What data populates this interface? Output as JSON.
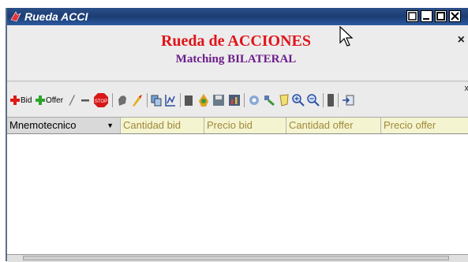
{
  "window": {
    "title": "Rueda ACCI"
  },
  "header": {
    "title": "Rueda de ACCIONES",
    "subtitle": "Matching BILATERAL",
    "close_label": "×"
  },
  "toolbar": {
    "bid_label": "Bid",
    "offer_label": "Offer",
    "close_label": "x",
    "icons": [
      "add-bid-icon",
      "add-offer-icon",
      "edit-icon",
      "minus-icon",
      "stop-icon",
      "hand-icon",
      "rocket-icon",
      "copy-icon",
      "chart-icon",
      "stack-icon",
      "bell-icon",
      "save-icon",
      "bar-chart-icon",
      "gear-icon",
      "filter-icon",
      "sticker-icon",
      "zoom-in-icon",
      "zoom-out-icon",
      "phone-icon",
      "export-icon"
    ]
  },
  "grid": {
    "columns": [
      "Mnemotecnico",
      "Cantidad bid",
      "Precio bid",
      "Cantidad offer",
      "Precio offer"
    ]
  },
  "colors": {
    "title_red": "#e0141a",
    "subtitle_purple": "#6b1c8a",
    "titlebar_blue": "#1c3d73",
    "column_text": "#a08a3a"
  }
}
